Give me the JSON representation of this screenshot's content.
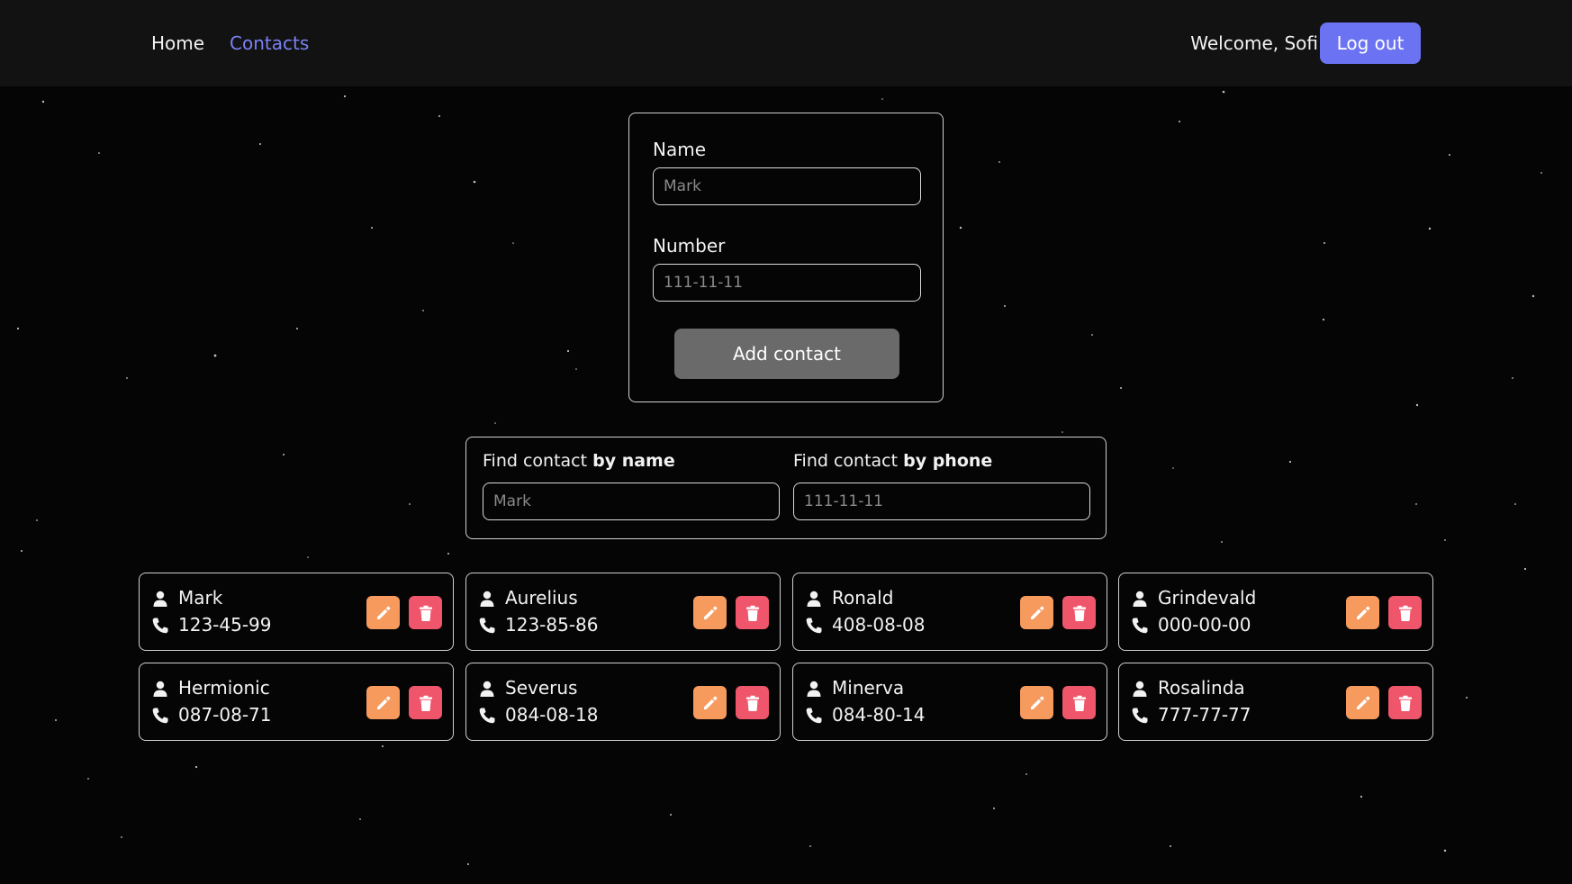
{
  "nav": {
    "home_label": "Home",
    "contacts_label": "Contacts",
    "welcome_text": "Welcome, Sofi",
    "logout_label": "Log out"
  },
  "add_form": {
    "name_label": "Name",
    "name_placeholder": "Mark",
    "number_label": "Number",
    "number_placeholder": "111-11-11",
    "submit_label": "Add contact"
  },
  "filter": {
    "by_name_prefix": "Find contact ",
    "by_name_bold": "by name",
    "by_name_placeholder": "Mark",
    "by_phone_prefix": "Find contact ",
    "by_phone_bold": "by phone",
    "by_phone_placeholder": "111-11-11"
  },
  "contacts": [
    {
      "name": "Mark",
      "phone": "123-45-99"
    },
    {
      "name": "Aurelius",
      "phone": "123-85-86"
    },
    {
      "name": "Ronald",
      "phone": "408-08-08"
    },
    {
      "name": "Grindevald",
      "phone": "000-00-00"
    },
    {
      "name": "Hermionic",
      "phone": "087-08-71"
    },
    {
      "name": "Severus",
      "phone": "084-08-18"
    },
    {
      "name": "Minerva",
      "phone": "084-80-14"
    },
    {
      "name": "Rosalinda",
      "phone": "777-77-77"
    }
  ],
  "icons": {
    "contact_person": "person-icon",
    "contact_phone": "phone-icon",
    "edit": "pencil-icon",
    "delete": "trash-icon"
  },
  "colors": {
    "accent": "#6b73f2",
    "active_nav": "#7a82f5",
    "edit_button": "#f79a5e",
    "delete_button": "#f0566b",
    "add_button": "#6a6a6a",
    "background": "#050505",
    "navbar": "#121212"
  }
}
